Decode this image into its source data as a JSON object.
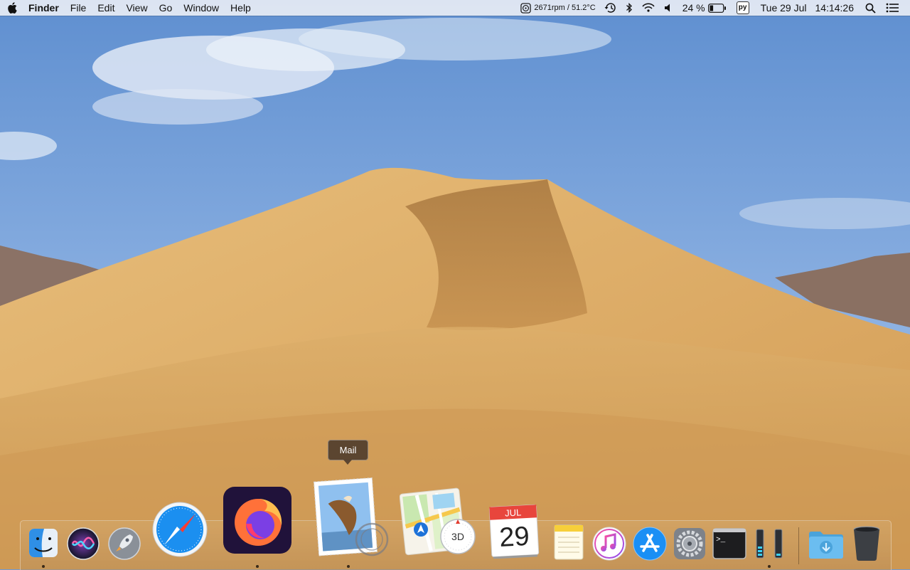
{
  "menubar": {
    "app_name": "Finder",
    "menus": [
      "File",
      "Edit",
      "View",
      "Go",
      "Window",
      "Help"
    ],
    "status": {
      "fan_temp": "2671rpm / 51.2°C",
      "battery_percent": "24 %",
      "python_badge": "py",
      "date": "Tue 29 Jul",
      "time": "14:14:26"
    }
  },
  "dock": {
    "tooltip": "Mail",
    "calendar_month": "JUL",
    "calendar_day": "29",
    "maps_badge": "3D",
    "terminal_prompt": ">_",
    "apps": [
      {
        "name": "Finder",
        "running": true
      },
      {
        "name": "Siri",
        "running": false
      },
      {
        "name": "Launchpad",
        "running": false
      },
      {
        "name": "Safari",
        "running": false
      },
      {
        "name": "Firefox",
        "running": true
      },
      {
        "name": "Mail",
        "running": true
      },
      {
        "name": "Maps",
        "running": false
      },
      {
        "name": "Calendar",
        "running": false
      },
      {
        "name": "Notes",
        "running": false
      },
      {
        "name": "iTunes",
        "running": false
      },
      {
        "name": "App Store",
        "running": false
      },
      {
        "name": "System Preferences",
        "running": false
      },
      {
        "name": "Terminal",
        "running": false
      },
      {
        "name": "Activity Monitor",
        "running": true
      },
      {
        "name": "Downloads",
        "running": false
      },
      {
        "name": "Trash",
        "running": false
      }
    ]
  },
  "colors": {
    "sky": "#6f9bd6",
    "dune": "#d9a862",
    "dock_tint": "#c99a5e",
    "menubar": "#eef0f6"
  }
}
